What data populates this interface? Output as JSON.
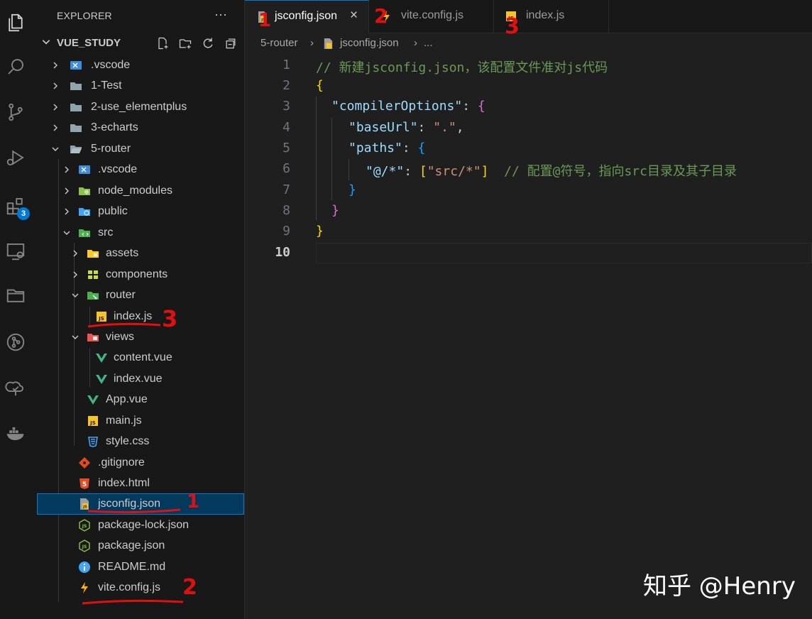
{
  "sidebar": {
    "title": "EXPLORER",
    "more_label": "···",
    "root_label": "VUE_STUDY",
    "items": [
      {
        "label": ".vscode"
      },
      {
        "label": "1-Test"
      },
      {
        "label": "2-use_elementplus"
      },
      {
        "label": "3-echarts"
      },
      {
        "label": "5-router"
      },
      {
        "label": ".vscode"
      },
      {
        "label": "node_modules"
      },
      {
        "label": "public"
      },
      {
        "label": "src"
      },
      {
        "label": "assets"
      },
      {
        "label": "components"
      },
      {
        "label": "router"
      },
      {
        "label": "index.js"
      },
      {
        "label": "views"
      },
      {
        "label": "content.vue"
      },
      {
        "label": "index.vue"
      },
      {
        "label": "App.vue"
      },
      {
        "label": "main.js"
      },
      {
        "label": "style.css"
      },
      {
        "label": ".gitignore"
      },
      {
        "label": "index.html"
      },
      {
        "label": "jsconfig.json"
      },
      {
        "label": "package-lock.json"
      },
      {
        "label": "package.json"
      },
      {
        "label": "README.md"
      },
      {
        "label": "vite.config.js"
      }
    ]
  },
  "activity": {
    "extensions_badge": "3"
  },
  "tabs": [
    {
      "label": "jsconfig.json",
      "close": "×"
    },
    {
      "label": "vite.config.js"
    },
    {
      "label": "index.js"
    }
  ],
  "breadcrumb": {
    "folder": "5-router",
    "file": "jsconfig.json",
    "more": "..."
  },
  "code": {
    "line_numbers": [
      "1",
      "2",
      "3",
      "4",
      "5",
      "6",
      "7",
      "8",
      "9",
      "10"
    ],
    "comment_1": "// 新建jsconfig.json，该配置文件准对js代码",
    "brace_open": "{",
    "key_compiler": "\"compilerOptions\"",
    "key_baseurl": "\"baseUrl\"",
    "val_baseurl": "\".\"",
    "key_paths": "\"paths\"",
    "key_alias": "\"@/*\"",
    "val_alias": "\"src/*\"",
    "comment_2": "// 配置@符号，指向src目录及其子目录",
    "brace_close": "}"
  },
  "annotations": {
    "one": "1",
    "two": "2",
    "three": "3"
  },
  "watermark": "知乎 @Henry"
}
